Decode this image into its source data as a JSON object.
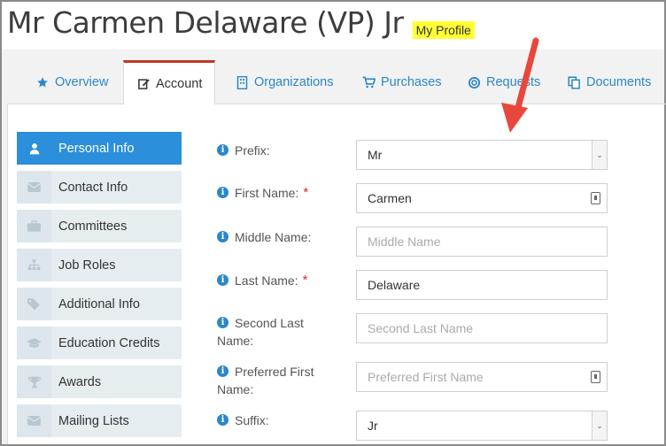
{
  "header": {
    "title": "Mr Carmen Delaware (VP) Jr",
    "badge": "My Profile"
  },
  "tabs": [
    {
      "label": "Overview",
      "icon": "star-icon"
    },
    {
      "label": "Account",
      "icon": "edit-icon"
    },
    {
      "label": "Organizations",
      "icon": "building-icon"
    },
    {
      "label": "Purchases",
      "icon": "cart-icon"
    },
    {
      "label": "Requests",
      "icon": "lifebuoy-icon"
    },
    {
      "label": "Documents",
      "icon": "copy-icon"
    }
  ],
  "sidebar": {
    "items": [
      {
        "label": "Personal Info",
        "icon": "user-icon"
      },
      {
        "label": "Contact Info",
        "icon": "envelope-icon"
      },
      {
        "label": "Committees",
        "icon": "briefcase-icon"
      },
      {
        "label": "Job Roles",
        "icon": "sitemap-icon"
      },
      {
        "label": "Additional Info",
        "icon": "tags-icon"
      },
      {
        "label": "Education Credits",
        "icon": "graduation-cap-icon"
      },
      {
        "label": "Awards",
        "icon": "trophy-icon"
      },
      {
        "label": "Mailing Lists",
        "icon": "envelope-icon"
      }
    ]
  },
  "form": {
    "prefix": {
      "label": "Prefix:",
      "value": "Mr"
    },
    "first_name": {
      "label": "First Name:",
      "value": "Carmen",
      "required": "*"
    },
    "middle_name": {
      "label": "Middle Name:",
      "placeholder": "Middle Name"
    },
    "last_name": {
      "label": "Last Name:",
      "value": "Delaware",
      "required": "*"
    },
    "second_last_name": {
      "label_line1": "Second Last",
      "label_line2": "Name:",
      "placeholder": "Second Last Name"
    },
    "preferred_first_name": {
      "label_line1": "Preferred First",
      "label_line2": "Name:",
      "placeholder": "Preferred First Name"
    },
    "suffix": {
      "label": "Suffix:",
      "value": "Jr"
    }
  },
  "colors": {
    "accent": "#2b87c8",
    "active_nav": "#2b8fdb",
    "active_tab_border": "#c0392b",
    "badge": "#ffff33",
    "arrow": "#e8473b",
    "required": "#d62b2b"
  }
}
